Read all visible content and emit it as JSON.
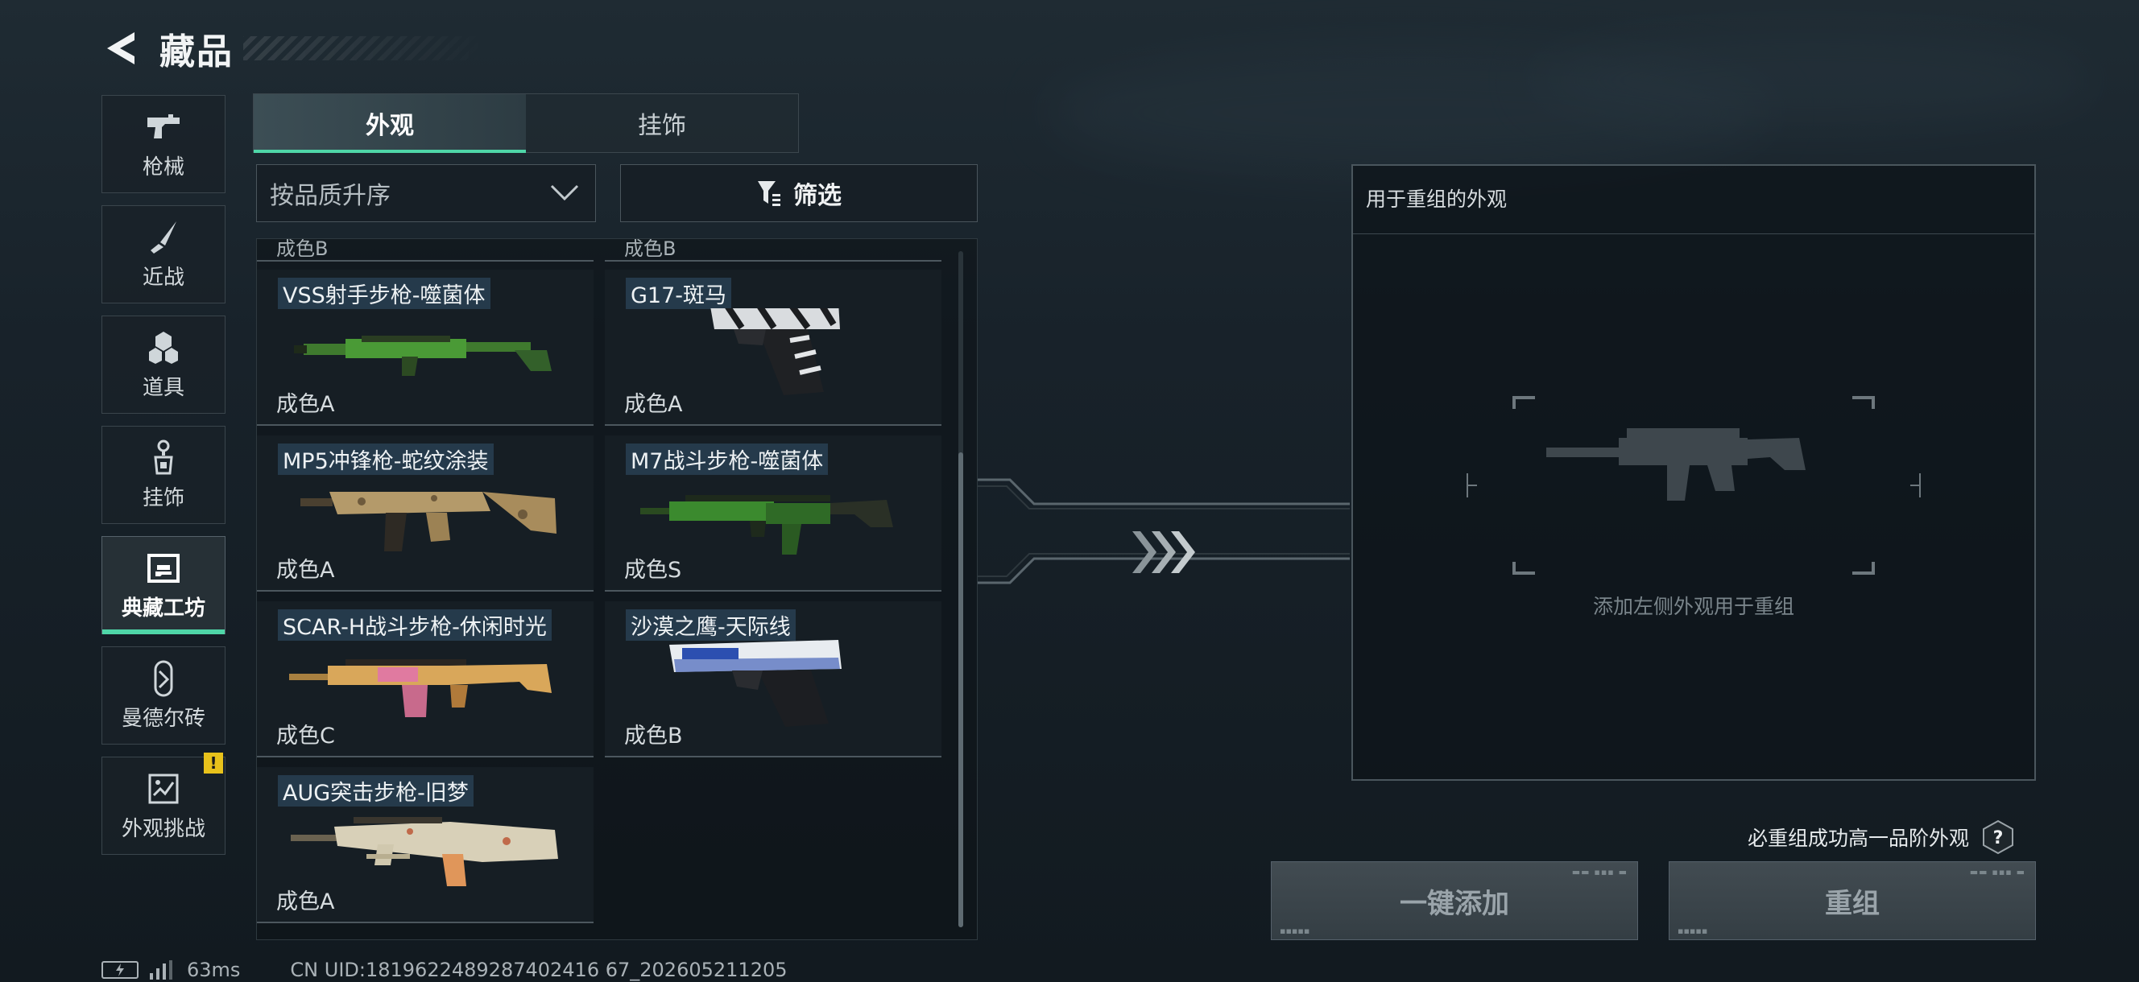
{
  "header": {
    "title": "藏品",
    "back_icon": "back-chevron-icon"
  },
  "side_nav": {
    "items": [
      {
        "label": "枪械",
        "icon": "pistol-icon",
        "active": false
      },
      {
        "label": "近战",
        "icon": "knife-icon",
        "active": false
      },
      {
        "label": "道具",
        "icon": "grenade-cluster-icon",
        "active": false
      },
      {
        "label": "挂饰",
        "icon": "charm-icon",
        "active": false
      },
      {
        "label": "典藏工坊",
        "icon": "workshop-frame-icon",
        "active": true
      },
      {
        "label": "曼德尔砖",
        "icon": "mandel-brick-icon",
        "active": false
      },
      {
        "label": "外观挑战",
        "icon": "challenge-icon",
        "active": false,
        "badge": "!"
      }
    ]
  },
  "tabs": [
    {
      "label": "外观",
      "active": true
    },
    {
      "label": "挂饰",
      "active": false
    }
  ],
  "sort": {
    "value": "按品质升序"
  },
  "filter": {
    "label": "筛选"
  },
  "list": {
    "cut_off_left": "成色B",
    "cut_off_right": "成色B",
    "items": [
      {
        "name": "VSS射手步枪-噬菌体",
        "grade": "成色A",
        "skin": "green"
      },
      {
        "name": "G17-斑马",
        "grade": "成色A",
        "skin": "zebra"
      },
      {
        "name": "MP5冲锋枪-蛇纹涂装",
        "grade": "成色A",
        "skin": "snake"
      },
      {
        "name": "M7战斗步枪-噬菌体",
        "grade": "成色S",
        "skin": "green"
      },
      {
        "name": "SCAR-H战斗步枪-休闲时光",
        "grade": "成色C",
        "skin": "pink-tan"
      },
      {
        "name": "沙漠之鹰-天际线",
        "grade": "成色B",
        "skin": "skyline"
      },
      {
        "name": "AUG突击步枪-旧梦",
        "grade": "成色A",
        "skin": "cream"
      }
    ]
  },
  "recombine": {
    "panel_title": "用于重组的外观",
    "hint": "添加左侧外观用于重组",
    "guarantee": "必重组成功高一品阶外观",
    "help": "?",
    "add_all_button": "一键添加",
    "recombine_button": "重组"
  },
  "status": {
    "ping": "63ms",
    "uid": "CN UID:1819622489287402416 67_202605211205"
  },
  "colors": {
    "accent": "#4fd6a8",
    "warning": "#e8c21b"
  }
}
